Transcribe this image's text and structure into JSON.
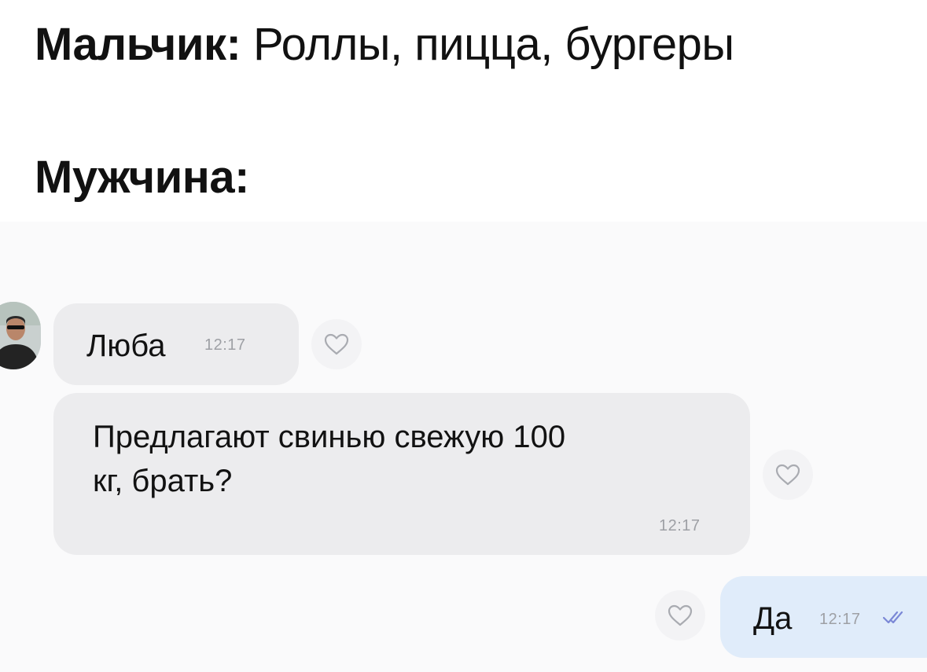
{
  "captions": {
    "boy_label": "Мальчик:",
    "boy_text": "Роллы,  пицца, бургеры",
    "man_label": "Мужчина:"
  },
  "chat": {
    "sender_name": {
      "text": "Люба",
      "time": "12:17"
    },
    "incoming_message": {
      "line1": "Предлагают свинью свежую 100",
      "line2": "кг, брать?",
      "time": "12:17"
    },
    "outgoing_message": {
      "text": "Да",
      "time": "12:17",
      "status_icon": "double-check-icon"
    },
    "reaction_icon": "heart-outline-icon",
    "colors": {
      "incoming_bubble": "#ececee",
      "outgoing_bubble": "#e0ecfa",
      "read_check": "#7b88d6"
    }
  }
}
